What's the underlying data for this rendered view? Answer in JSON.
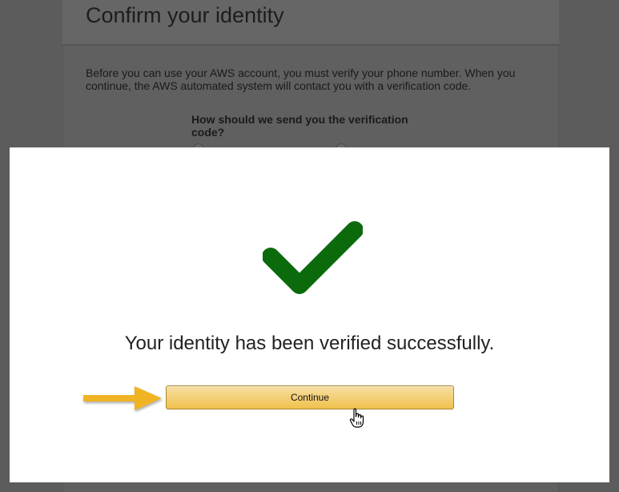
{
  "background_page": {
    "title": "Confirm your identity",
    "intro": "Before you can use your AWS account, you must verify your phone number. When you continue, the AWS automated system will contact you with a verification code.",
    "question": "How should we send you the verification code?"
  },
  "modal": {
    "success_message": "Your identity has been verified successfully.",
    "continue_label": "Continue"
  },
  "colors": {
    "checkmark": "#0b6a0b",
    "button_top": "#f7dfa5",
    "button_bottom": "#f0c14b",
    "annotation_arrow": "#f0b323"
  },
  "icons": {
    "success": "checkmark-icon",
    "pointer": "arrow-annotation",
    "cursor": "hand-cursor-icon"
  }
}
